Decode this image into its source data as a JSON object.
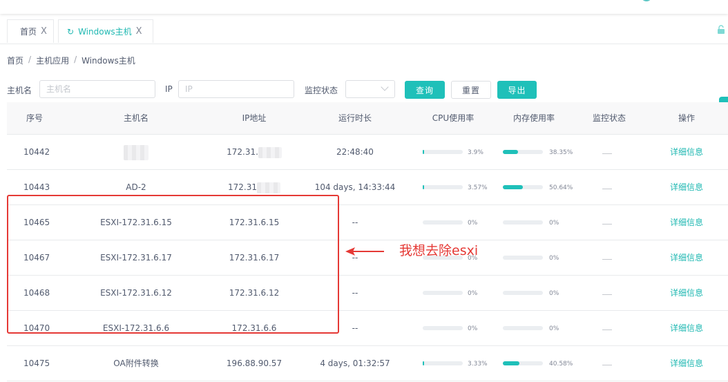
{
  "tabs": [
    {
      "label": "首页",
      "close": "X",
      "active": false
    },
    {
      "label": "Windows主机",
      "close": "X",
      "active": true
    }
  ],
  "breadcrumb": [
    "首页",
    "主机应用",
    "Windows主机"
  ],
  "breadcrumb_sep": "/",
  "filters": {
    "hostname_label": "主机名",
    "hostname_placeholder": "主机名",
    "ip_label": "IP",
    "ip_placeholder": "IP",
    "status_label": "监控状态",
    "query_label": "查询",
    "reset_label": "重置",
    "export_label": "导出"
  },
  "table": {
    "columns": [
      "序号",
      "主机名",
      "IP地址",
      "运行时长",
      "CPU使用率",
      "内存使用率",
      "监控状态",
      "操作"
    ],
    "rows": [
      {
        "id": "10442",
        "hostname": "",
        "hostname_redacted": true,
        "ip": "172.31.",
        "ip_redacted": true,
        "uptime": "22:48:40",
        "cpu": 3.9,
        "cpu_label": "3.9%",
        "mem": 38.35,
        "mem_label": "38.35%",
        "action": "详细信息"
      },
      {
        "id": "10443",
        "hostname": "AD-2",
        "hostname_redacted": false,
        "ip": "172.31",
        "ip_redacted": true,
        "uptime": "104 days, 14:33:44",
        "cpu": 3.57,
        "cpu_label": "3.57%",
        "mem": 50.64,
        "mem_label": "50.64%",
        "action": "详细信息"
      },
      {
        "id": "10465",
        "hostname": "ESXI-172.31.6.15",
        "hostname_redacted": false,
        "ip": "172.31.6.15",
        "ip_redacted": false,
        "uptime": "--",
        "cpu": 0,
        "cpu_label": "0%",
        "mem": 0,
        "mem_label": "0%",
        "action": "详细信息"
      },
      {
        "id": "10467",
        "hostname": "ESXI-172.31.6.17",
        "hostname_redacted": false,
        "ip": "172.31.6.17",
        "ip_redacted": false,
        "uptime": "--",
        "cpu": 0,
        "cpu_label": "0%",
        "mem": 0,
        "mem_label": "0%",
        "action": "详细信息"
      },
      {
        "id": "10468",
        "hostname": "ESXI-172.31.6.12",
        "hostname_redacted": false,
        "ip": "172.31.6.12",
        "ip_redacted": false,
        "uptime": "--",
        "cpu": 0,
        "cpu_label": "0%",
        "mem": 0,
        "mem_label": "0%",
        "action": "详细信息"
      },
      {
        "id": "10470",
        "hostname": "ESXI-172.31.6.6",
        "hostname_redacted": false,
        "ip": "172.31.6.6",
        "ip_redacted": false,
        "uptime": "--",
        "cpu": 0,
        "cpu_label": "0%",
        "mem": 0,
        "mem_label": "0%",
        "action": "详细信息"
      },
      {
        "id": "10475",
        "hostname": "OA附件转换",
        "hostname_redacted": false,
        "ip": "196.88.90.57",
        "ip_redacted": false,
        "uptime": "4 days, 01:32:57",
        "cpu": 3.33,
        "cpu_label": "3.33%",
        "mem": 40.58,
        "mem_label": "40.58%",
        "action": "详细信息"
      }
    ]
  },
  "annotation": {
    "text": "我想去除esxi",
    "color": "#e53935"
  },
  "colors": {
    "accent": "#1fc0b9",
    "annotation": "#e53935"
  }
}
